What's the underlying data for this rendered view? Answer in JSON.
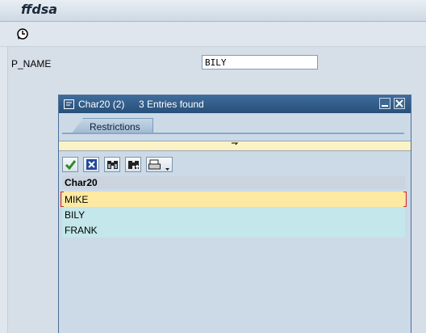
{
  "window": {
    "title": "ffdsa"
  },
  "toolbar": {
    "execute_icon": "execute-clock-icon"
  },
  "form": {
    "parameter_label": "P_NAME",
    "parameter_value": "BILY"
  },
  "dialog": {
    "title": "Char20 (2)",
    "entries_found": "3 Entries found",
    "tab_label": "Restrictions",
    "column_header": "Char20",
    "rows": [
      "MIKE",
      "BILY",
      "FRANK"
    ],
    "selected_row": "MIKE",
    "toolbar_icons": [
      "checkmark-icon",
      "cancel-icon",
      "find-icon",
      "find-next-icon",
      "print-icon"
    ]
  },
  "colors": {
    "header_blue": "#2f5a86",
    "selection_yellow": "#fde9a1",
    "row_cyan": "#c3e7ea",
    "check_green": "#2e8b1e"
  }
}
